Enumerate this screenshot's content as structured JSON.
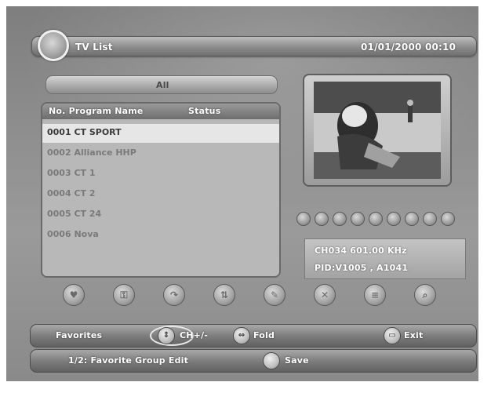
{
  "header": {
    "title": "TV List",
    "datetime": "01/01/2000 00:10"
  },
  "filter": {
    "label": "All"
  },
  "list": {
    "headers": [
      "No. Program Name",
      "Status"
    ],
    "rows": [
      "0001 CT SPORT",
      "0002 Alliance HHP",
      "0003 CT 1",
      "0004 CT 2",
      "0005 CT 24",
      "0006 Nova"
    ],
    "selected_index": 0
  },
  "info": {
    "frequency": "CH034 601.00 KHz",
    "pid": "PID:V1005 , A1041"
  },
  "footer": {
    "favorites_label": "Favorites",
    "ch_label": "CH+/-",
    "fold_label": "Fold",
    "exit_label": "Exit",
    "fav_group_label": "1/2: Favorite Group Edit",
    "save_label": "Save"
  },
  "icons": {
    "logo": "disc-logo-icon",
    "function_row": [
      "heart-icon",
      "lock-icon",
      "skip-icon",
      "move-icon",
      "rename-icon",
      "delete-icon",
      "sort-icon",
      "find-icon"
    ],
    "key_ch": "up-down-arrows-icon",
    "key_fold": "left-right-arrows-icon",
    "key_exit": "exit-icon"
  }
}
